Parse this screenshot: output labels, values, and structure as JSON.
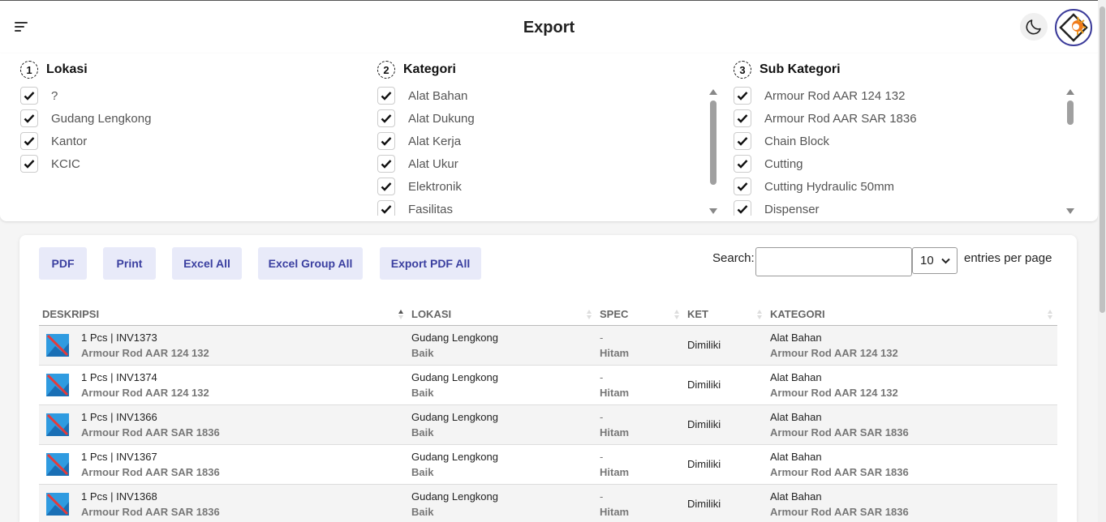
{
  "header": {
    "title": "Export"
  },
  "filters": {
    "lokasi": {
      "step": "1",
      "title": "Lokasi",
      "items": [
        "?",
        "Gudang Lengkong",
        "Kantor",
        "KCIC"
      ]
    },
    "kategori": {
      "step": "2",
      "title": "Kategori",
      "items": [
        "Alat Bahan",
        "Alat Dukung",
        "Alat Kerja",
        "Alat Ukur",
        "Elektronik",
        "Fasilitas"
      ]
    },
    "sub_kategori": {
      "step": "3",
      "title": "Sub Kategori",
      "items": [
        "Armour Rod AAR 124 132",
        "Armour Rod AAR SAR 1836",
        "Chain Block",
        "Cutting",
        "Cutting Hydraulic 50mm",
        "Dispenser"
      ]
    }
  },
  "toolbar": {
    "pdf": "PDF",
    "print": "Print",
    "excel_all": "Excel All",
    "excel_group_all": "Excel Group All",
    "export_pdf_all": "Export PDF All",
    "search_label": "Search:",
    "search_value": "",
    "entries_value": "10",
    "entries_label": "entries per page"
  },
  "table": {
    "columns": [
      "DESKRIPSI",
      "LOKASI",
      "SPEC",
      "KET",
      "KATEGORI"
    ],
    "rows": [
      {
        "desc_line1": "1 Pcs | INV1373",
        "desc_line2": "Armour Rod AAR 124 132",
        "lokasi": "Gudang Lengkong",
        "kondisi": "Baik",
        "spec": "-",
        "warna": "Hitam",
        "ket": "Dimiliki",
        "kategori": "Alat Bahan",
        "sub_kategori": "Armour Rod AAR 124 132"
      },
      {
        "desc_line1": "1 Pcs | INV1374",
        "desc_line2": "Armour Rod AAR 124 132",
        "lokasi": "Gudang Lengkong",
        "kondisi": "Baik",
        "spec": "-",
        "warna": "Hitam",
        "ket": "Dimiliki",
        "kategori": "Alat Bahan",
        "sub_kategori": "Armour Rod AAR 124 132"
      },
      {
        "desc_line1": "1 Pcs | INV1366",
        "desc_line2": "Armour Rod AAR SAR 1836",
        "lokasi": "Gudang Lengkong",
        "kondisi": "Baik",
        "spec": "-",
        "warna": "Hitam",
        "ket": "Dimiliki",
        "kategori": "Alat Bahan",
        "sub_kategori": "Armour Rod AAR SAR 1836"
      },
      {
        "desc_line1": "1 Pcs | INV1367",
        "desc_line2": "Armour Rod AAR SAR 1836",
        "lokasi": "Gudang Lengkong",
        "kondisi": "Baik",
        "spec": "-",
        "warna": "Hitam",
        "ket": "Dimiliki",
        "kategori": "Alat Bahan",
        "sub_kategori": "Armour Rod AAR SAR 1836"
      },
      {
        "desc_line1": "1 Pcs | INV1368",
        "desc_line2": "Armour Rod AAR SAR 1836",
        "lokasi": "Gudang Lengkong",
        "kondisi": "Baik",
        "spec": "-",
        "warna": "Hitam",
        "ket": "Dimiliki",
        "kategori": "Alat Bahan",
        "sub_kategori": "Armour Rod AAR SAR 1836"
      }
    ]
  },
  "colors": {
    "button_bg": "#e8eaf9",
    "button_text": "#3a3fa0",
    "avatar_border": "#3b3b9a"
  }
}
